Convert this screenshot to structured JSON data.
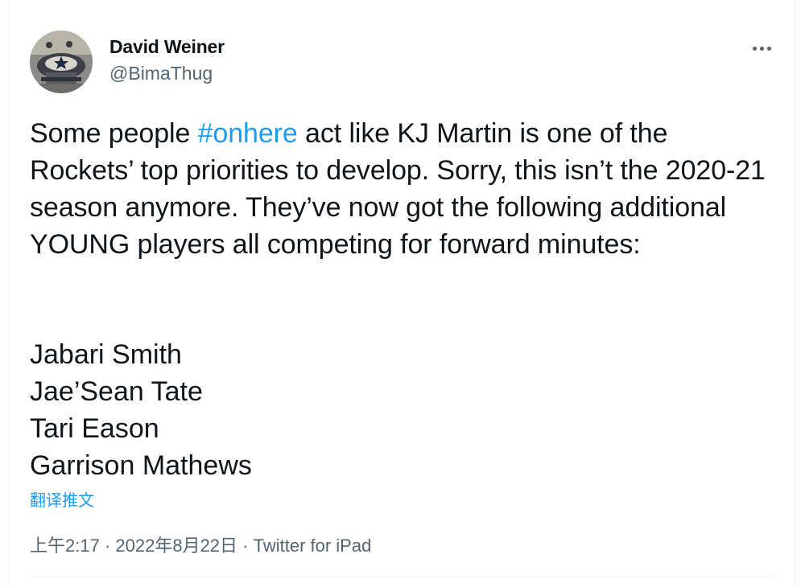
{
  "author": {
    "display_name": "David Weiner",
    "handle": "@BimaThug"
  },
  "tweet": {
    "text_part1": "Some people ",
    "hashtag": "#onhere",
    "text_part2": " act like KJ Martin is one of the Rockets’ top priorities to develop. Sorry, this isn’t the 2020-21 season anymore. They’ve now got the following additional YOUNG players all competing for forward minutes:",
    "players": [
      "Jabari Smith",
      "Jae’Sean Tate",
      "Tari Eason",
      "Garrison Mathews"
    ],
    "translate_label": "翻译推文"
  },
  "meta": {
    "time": "上午2:17",
    "separator": " · ",
    "date": "2022年8月22日",
    "source": "Twitter for iPad"
  },
  "colors": {
    "link": "#1d9bf0",
    "secondary_text": "#536471",
    "primary_text": "#0f1419"
  }
}
